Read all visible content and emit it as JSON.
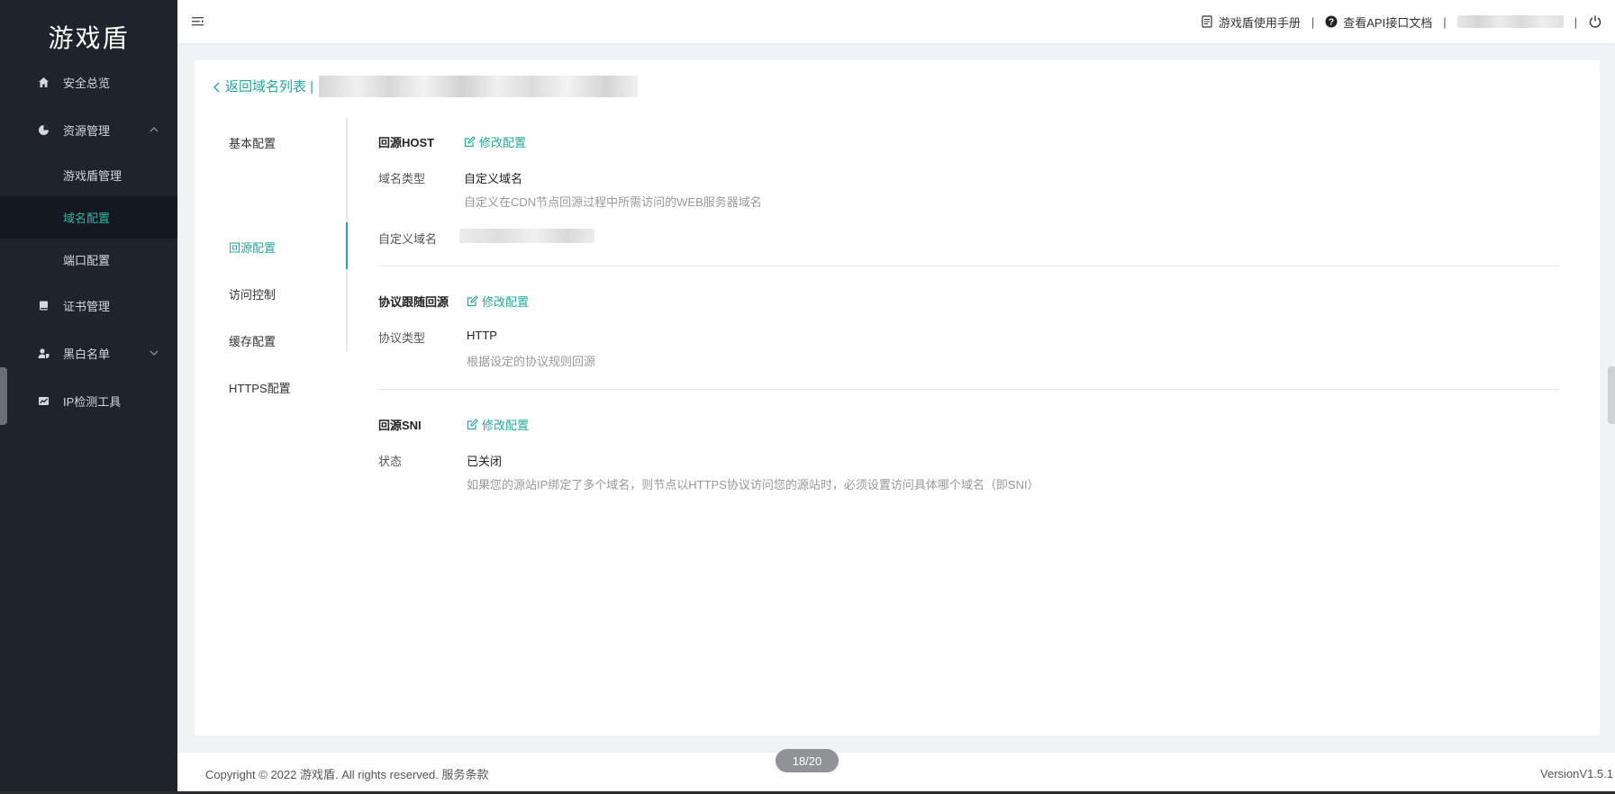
{
  "app": {
    "brand": "游戏盾"
  },
  "sidebar": {
    "items": [
      {
        "label": "安全总览",
        "icon": "home-icon"
      },
      {
        "label": "资源管理",
        "icon": "pie-chart-icon",
        "expanded": true
      },
      {
        "label": "证书管理",
        "icon": "book-icon"
      },
      {
        "label": "黑白名单",
        "icon": "user-shield-icon",
        "expanded": false
      },
      {
        "label": "IP检测工具",
        "icon": "line-chart-icon"
      }
    ],
    "sub_items": [
      {
        "label": "游戏盾管理"
      },
      {
        "label": "域名配置",
        "active": true
      },
      {
        "label": "端口配置"
      }
    ]
  },
  "header": {
    "manual_label": "游戏盾使用手册",
    "api_doc_label": "查看API接口文档",
    "separator": "|"
  },
  "page": {
    "back_label": "返回域名列表 |",
    "tabs": [
      {
        "label": "基本配置"
      },
      {
        "label": "回源配置",
        "active": true
      },
      {
        "label": "访问控制"
      },
      {
        "label": "缓存配置"
      },
      {
        "label": "HTTPS配置"
      }
    ],
    "sections": {
      "host": {
        "title": "回源HOST",
        "edit_label": "修改配置",
        "type_label": "域名类型",
        "type_value": "自定义域名",
        "type_hint": "自定义在CDN节点回源过程中所需访问的WEB服务器域名",
        "custom_label": "自定义域名"
      },
      "protocol": {
        "title": "协议跟随回源",
        "edit_label": "修改配置",
        "type_label": "协议类型",
        "type_value": "HTTP",
        "type_hint": "根据设定的协议规则回源"
      },
      "sni": {
        "title": "回源SNI",
        "edit_label": "修改配置",
        "status_label": "状态",
        "status_value": "已关闭",
        "status_hint": "如果您的源站IP绑定了多个域名，则节点以HTTPS协议访问您的源站时，必须设置访问具体哪个域名（即SNI）"
      }
    }
  },
  "footer": {
    "copyright": "Copyright © 2022 游戏盾. All rights reserved. 服务条款",
    "version": "VersionV1.5.1"
  },
  "page_indicator": "18/20",
  "colors": {
    "accent": "#26a69a",
    "sidebar_bg": "#1f232c",
    "sidebar_active_bg": "#141820"
  }
}
